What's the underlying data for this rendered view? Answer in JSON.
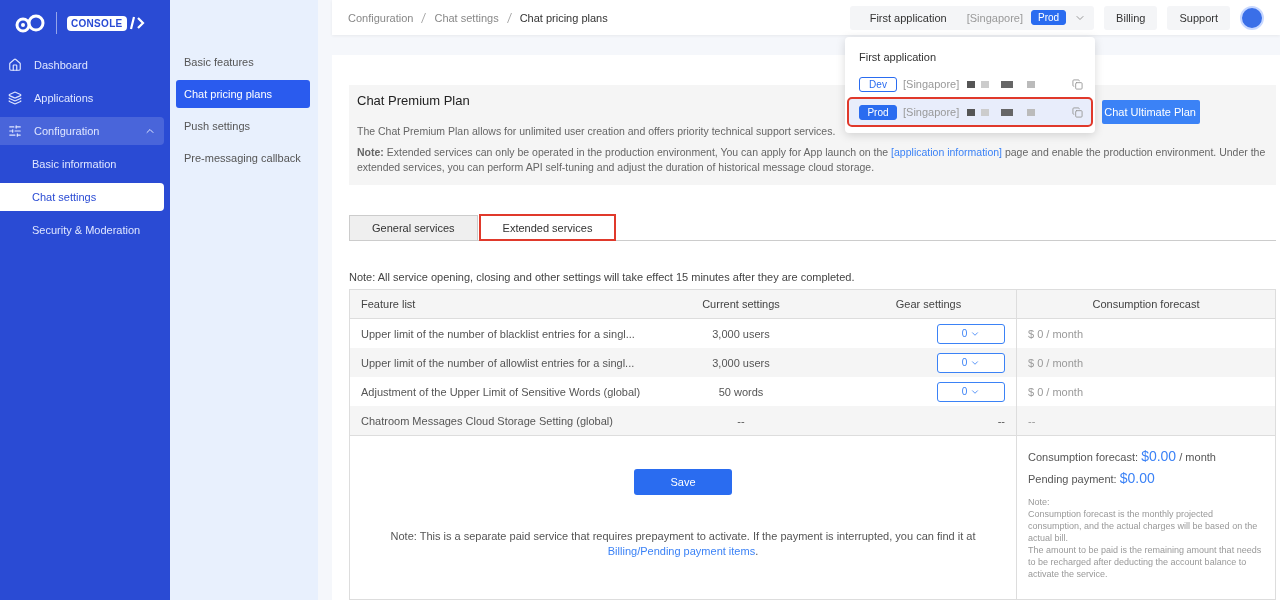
{
  "brand": {
    "logo_text": "CONSOLE"
  },
  "sidebar": {
    "items": [
      {
        "kind": "link",
        "label": "Dashboard",
        "selected": false
      },
      {
        "kind": "link",
        "label": "Applications",
        "selected": false
      },
      {
        "kind": "group",
        "label": "Configuration",
        "expanded": true,
        "children": [
          {
            "label": "Basic information",
            "selected": false
          },
          {
            "label": "Chat settings",
            "selected": true
          },
          {
            "label": "Security & Moderation",
            "selected": false
          }
        ]
      }
    ]
  },
  "subnav": [
    {
      "label": "Basic features",
      "selected": false
    },
    {
      "label": "Chat pricing plans",
      "selected": true
    },
    {
      "label": "Push settings",
      "selected": false
    },
    {
      "label": "Pre-messaging callback",
      "selected": false
    }
  ],
  "breadcrumb": [
    "Configuration",
    "Chat settings",
    "Chat pricing plans"
  ],
  "header": {
    "app": "First application",
    "region": "[Singapore]",
    "env": "Prod",
    "buttons": [
      "Billing",
      "Support"
    ]
  },
  "app_menu": {
    "title": "First application",
    "items": [
      {
        "env": "Dev",
        "region": "[Singapore]",
        "selected": false,
        "highlighted": false
      },
      {
        "env": "Prod",
        "region": "[Singapore]",
        "selected": true,
        "highlighted": true
      }
    ]
  },
  "plan": {
    "title": "Chat Premium Plan",
    "description": "The Chat Premium Plan allows for unlimited user creation and offers priority technical support services.",
    "note_before": "**Note:** Extended services can only be operated in the production environment, You can apply for App launch on the ",
    "note_link": "[application information]",
    "note_after": " page and enable the production environment. Under the extended services, you can perform API self-tuning and adjust the duration of historical message cloud storage.",
    "upgrade_button": "Chat Ultimate Plan"
  },
  "tabs": [
    {
      "label": "General services",
      "selected": false,
      "highlighted": false
    },
    {
      "label": "Extended services",
      "selected": true,
      "highlighted": true
    }
  ],
  "notice": "Note: All service opening, closing and other settings will take effect 15 minutes after they are completed.",
  "table": {
    "columns": [
      "Feature list",
      "Current settings",
      "Gear settings",
      "Consumption forecast"
    ],
    "rows": [
      {
        "feature": "Upper limit of the number of blacklist entries for a singl...",
        "current": "3,000 users",
        "kind": "select",
        "gear": "0",
        "forecast": "$ 0 / month"
      },
      {
        "feature": "Upper limit of the number of allowlist entries for a singl...",
        "current": "3,000 users",
        "kind": "select",
        "gear": "0",
        "forecast": "$ 0 / month"
      },
      {
        "feature": "Adjustment of the Upper Limit of Sensitive Words (global)",
        "current": "50 words",
        "kind": "select",
        "gear": "0",
        "forecast": "$ 0 / month"
      },
      {
        "feature": "Chatroom Messages Cloud Storage Setting (global)",
        "current": "--",
        "kind": "text",
        "gear": "--",
        "forecast": "--"
      }
    ]
  },
  "footer": {
    "save": "Save",
    "note": "Note: This is a separate paid service that requires prepayment to activate. If the payment is interrupted, you can find it at",
    "link": "Billing/Pending payment items",
    "link_after": ".",
    "forecast_label": "Consumption forecast:",
    "forecast_value": "$0.00",
    "forecast_unit": "/ month",
    "pending_label": "Pending payment:",
    "pending_value": "$0.00",
    "notes": [
      "Note:",
      "Consumption forecast is the monthly projected consumption, and the actual charges will be based on the actual bill.",
      "The amount to be paid is the remaining amount that needs to be recharged after deducting the account balance to activate the service."
    ]
  }
}
